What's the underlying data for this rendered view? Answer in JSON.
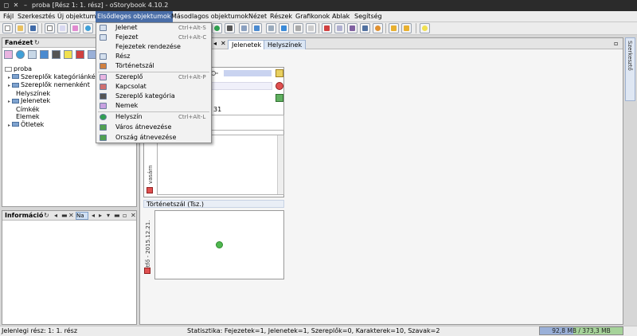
{
  "window": {
    "title": "proba [Rész 1: 1. rész] - oStorybook 4.10.2"
  },
  "menubar": {
    "items": [
      "Fájl",
      "Szerkesztés",
      "Új objektum",
      "Elsődleges objektumok",
      "Másodlagos objektumok",
      "Nézet",
      "Részek",
      "Grafikonok",
      "Ablak",
      "Segítség"
    ],
    "active": "Elsődleges objektumok"
  },
  "dropdown": {
    "items": [
      {
        "label": "Jelenet",
        "shortcut": "Ctrl+Alt-S",
        "icon": "scene-icon"
      },
      {
        "label": "Fejezet",
        "shortcut": "Ctrl+Alt-C",
        "icon": "chapter-icon"
      },
      {
        "label": "Fejezetek rendezése",
        "shortcut": "",
        "icon": ""
      },
      {
        "label": "Rész",
        "shortcut": "",
        "icon": "part-icon"
      },
      {
        "label": "Történetszál",
        "shortcut": "",
        "icon": "strand-icon"
      },
      {
        "label": "Szereplő",
        "shortcut": "Ctrl+Alt-P",
        "icon": "person-icon"
      },
      {
        "label": "Kapcsolat",
        "shortcut": "",
        "icon": "relation-icon"
      },
      {
        "label": "Szereplő kategória",
        "shortcut": "",
        "icon": "category-icon"
      },
      {
        "label": "Nemek",
        "shortcut": "",
        "icon": "gender-icon"
      },
      {
        "label": "Helyszín",
        "shortcut": "Ctrl+Alt-L",
        "icon": "globe-icon"
      },
      {
        "label": "Város átnevezése",
        "shortcut": "",
        "icon": "rename-icon"
      },
      {
        "label": "Ország átnevezése",
        "shortcut": "",
        "icon": "rename-icon"
      }
    ]
  },
  "fanezet": {
    "title": "Fanézet",
    "tree": [
      {
        "label": "proba",
        "level": 0,
        "folder": false
      },
      {
        "label": "Szereplők kategóriánként",
        "level": 1,
        "folder": true
      },
      {
        "label": "Szereplők nemenként",
        "level": 1,
        "folder": true
      },
      {
        "label": "Helyszínek",
        "level": 1,
        "folder": false
      },
      {
        "label": "Jelenetek",
        "level": 1,
        "folder": true
      },
      {
        "label": "Címkék",
        "level": 1,
        "folder": false
      },
      {
        "label": "Elemek",
        "level": 1,
        "folder": false
      },
      {
        "label": "Ötletek",
        "level": 1,
        "folder": true
      }
    ]
  },
  "informacio": {
    "title": "Információ",
    "tab2": "Na"
  },
  "center": {
    "tabs": [
      "Jelenetek",
      "Helyszínek"
    ],
    "card_number": "31",
    "card_vertical": "vasárn",
    "section_title": "Történetszál (Tsz.)",
    "date_vertical": "hétfő - 2015.12.21."
  },
  "right_sidebar": {
    "label": "Szerkesztő"
  },
  "status": {
    "left": "Jelenlegi rész: 1: 1. rész",
    "stats": "Statisztika: Fejezetek=1, Jelenetek=1, Szereplők=0, Karakterek=10, Szavak=2",
    "memory": "92,8 MB / 373,3 MB",
    "memory_fraction": 0.249
  },
  "colors": {
    "accent": "#4a6ea8",
    "memory_used": "#9ab0d8",
    "memory_free": "#a6d39a"
  }
}
